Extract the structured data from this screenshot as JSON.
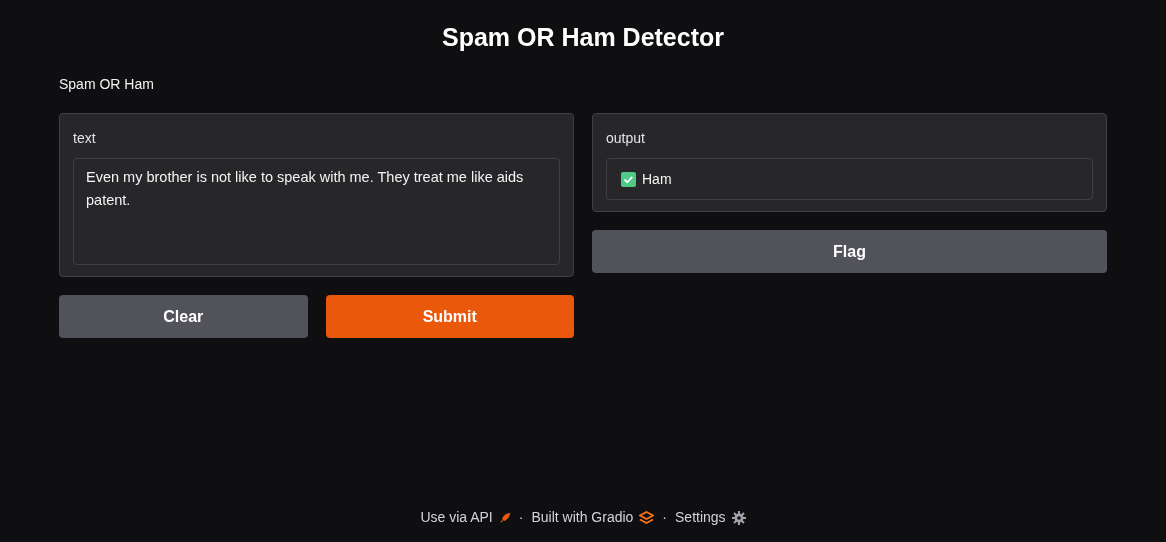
{
  "title": "Spam OR Ham Detector",
  "description": "Spam OR Ham",
  "input": {
    "label": "text",
    "value": "Even my brother is not like to speak with me. They treat me like aids patent."
  },
  "input_buttons": [
    {
      "label": "Clear",
      "kind": "secondary"
    },
    {
      "label": "Submit",
      "kind": "primary"
    }
  ],
  "output": {
    "label": "output",
    "value": "Ham"
  },
  "output_buttons": [
    {
      "label": "Flag",
      "kind": "secondary"
    }
  ],
  "footer": [
    {
      "label": "Use via API",
      "kind": "api"
    },
    {
      "label": "·",
      "kind": "separator"
    },
    {
      "label": "Built with Gradio",
      "kind": "gradio"
    },
    {
      "label": "·",
      "kind": "separator"
    },
    {
      "label": "Settings",
      "kind": "settings"
    }
  ]
}
